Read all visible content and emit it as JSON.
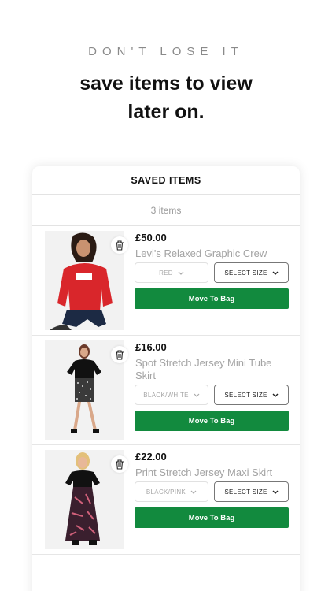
{
  "eyebrow": "DON'T LOSE IT",
  "headline": {
    "line1": "save items to view",
    "line2": "later on."
  },
  "card": {
    "title": "SAVED ITEMS",
    "count": "3 items",
    "items": [
      {
        "price": "£50.00",
        "name": "Levi's Relaxed Graphic Crew",
        "color": "RED",
        "size": "SELECT SIZE",
        "cta": "Move To Bag",
        "shirt_color": "#d9262b"
      },
      {
        "price": "£16.00",
        "name": "Spot Stretch Jersey Mini Tube Skirt",
        "color": "BLACK/WHITE",
        "size": "SELECT SIZE",
        "cta": "Move To Bag",
        "shirt_color": "#111111"
      },
      {
        "price": "£22.00",
        "name": "Print Stretch Jersey Maxi Skirt",
        "color": "BLACK/PINK",
        "size": "SELECT SIZE",
        "cta": "Move To Bag",
        "shirt_color": "#111111"
      }
    ]
  },
  "colors": {
    "accent": "#128a3e"
  }
}
